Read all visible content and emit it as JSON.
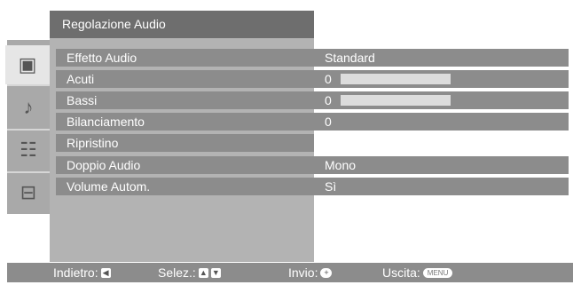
{
  "header": {
    "title": "Regolazione Audio"
  },
  "sidebar": {
    "items": [
      {
        "icon": "picture-icon",
        "glyph": "▣"
      },
      {
        "icon": "music-note-icon",
        "glyph": "♪"
      },
      {
        "icon": "features-icon",
        "glyph": "☷"
      },
      {
        "icon": "toolbox-icon",
        "glyph": "⊟"
      }
    ],
    "active_index": 0
  },
  "menu": {
    "rows": [
      {
        "label": "Effetto Audio",
        "value": "Standard"
      },
      {
        "label": "Acuti",
        "value": "0",
        "level": 0
      },
      {
        "label": "Bassi",
        "value": "0",
        "level": 0
      },
      {
        "label": "Bilanciamento",
        "value": "0"
      },
      {
        "label": "Ripristino",
        "value": ""
      },
      {
        "label": "Doppio Audio",
        "value": "Mono"
      },
      {
        "label": "Volume Autom.",
        "value": "Sì"
      }
    ]
  },
  "footer": {
    "back_label": "Indietro:",
    "select_label": "Selez.:",
    "enter_label": "Invio:",
    "exit_label": "Uscita:",
    "menu_key": "MENU"
  },
  "colors": {
    "title_bg": "#6e6e6e",
    "row_bg": "#8c8c8c",
    "panel_bg": "#b3b3b3",
    "sidebar_bg": "#a9a9a9"
  }
}
